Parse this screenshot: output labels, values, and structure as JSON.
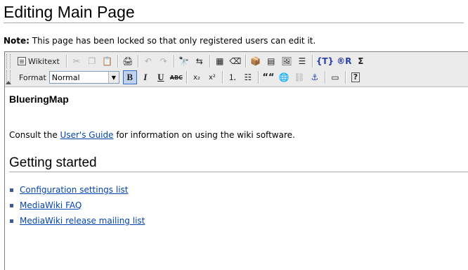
{
  "page": {
    "title": "Editing Main Page",
    "notice_label": "Note:",
    "notice_text": "This page has been locked so that only registered users can edit it."
  },
  "toolbar": {
    "wikitext_label": "Wikitext",
    "format_label": "Format",
    "format_value": "Normal",
    "bold_label": "B",
    "italic_label": "I",
    "underline_label": "U",
    "strike_label": "ABC",
    "subscript_label": "x₂",
    "superscript_label": "x²",
    "quote_label": "““",
    "template_label": "{T}",
    "reference_label": "®R",
    "sigma_label": "Σ",
    "help_label": "?"
  },
  "content": {
    "heading": "BlueringMap",
    "intro_before": "Consult the ",
    "intro_link": "User's Guide",
    "intro_after": " for information on using the wiki software.",
    "section_title": "Getting started",
    "links": [
      "Configuration settings list",
      "MediaWiki FAQ",
      "MediaWiki release mailing list"
    ]
  },
  "colors": {
    "link": "#0645ad",
    "toolbar_bg": "#ebebeb",
    "active_button": "#c1d2ee"
  }
}
